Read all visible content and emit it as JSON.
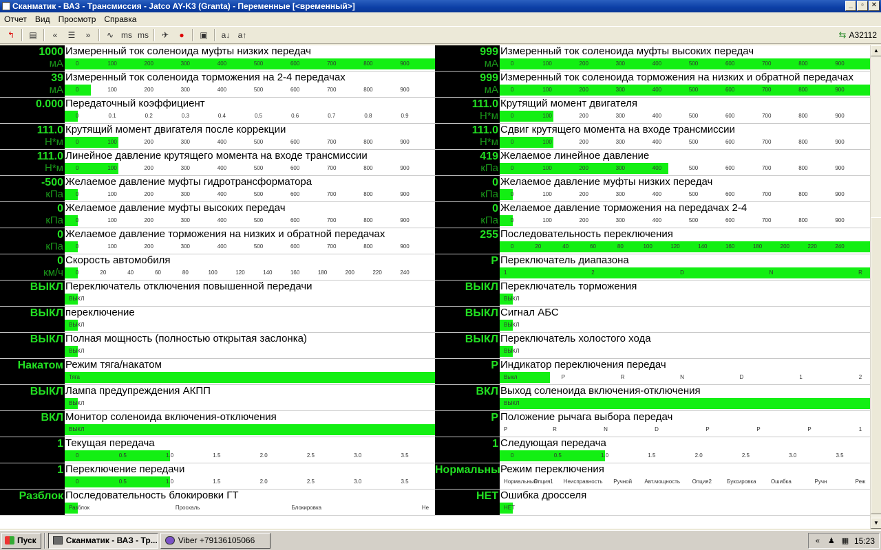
{
  "window": {
    "title": "Сканматик - ВАЗ - Трансмиссия - Jatco AY-K3 (Granta) - Переменные [<временный>]",
    "min": "_",
    "max": "▫",
    "close": "✕"
  },
  "menu": [
    "Отчет",
    "Вид",
    "Просмотр",
    "Справка"
  ],
  "toolbar": {
    "connection": "A32112",
    "icons": [
      "back-arrow-icon",
      "report-icon",
      "prev-icon",
      "list-icon",
      "next-icon",
      "graph-icon",
      "ms-icon",
      "ms-plus-icon",
      "plane-icon",
      "record-icon",
      "snapshot-icon",
      "sort-asc-icon",
      "sort-desc-icon"
    ]
  },
  "scales": {
    "s900": [
      "0",
      "100",
      "200",
      "300",
      "400",
      "500",
      "600",
      "700",
      "800",
      "900"
    ],
    "s09": [
      "0",
      "0.1",
      "0.2",
      "0.3",
      "0.4",
      "0.5",
      "0.6",
      "0.7",
      "0.8",
      "0.9"
    ],
    "s240": [
      "0",
      "20",
      "40",
      "60",
      "80",
      "100",
      "120",
      "140",
      "160",
      "180",
      "200",
      "220",
      "240"
    ],
    "s35": [
      "0",
      "0.5",
      "1.0",
      "1.5",
      "2.0",
      "2.5",
      "3.0",
      "3.5"
    ]
  },
  "left": [
    {
      "value": "1000",
      "unit": "мА",
      "label": "Измеренный ток соленоида муфты низких передач",
      "fill": 1.0,
      "scale": "s900"
    },
    {
      "value": "39",
      "unit": "мА",
      "label": "Измеренный ток соленоида торможения на 2-4 передачах",
      "fill": 0.07,
      "scale": "s900"
    },
    {
      "value": "0.000",
      "unit": "",
      "label": "Передаточный коэффициент",
      "fill": 0.035,
      "scale": "s09"
    },
    {
      "value": "111.0",
      "unit": "Н*м",
      "label": "Крутящий момент двигателя после коррекции",
      "fill": 0.145,
      "scale": "s900"
    },
    {
      "value": "111.0",
      "unit": "Н*м",
      "label": "Линейное давление крутящего момента на входе трансмиссии",
      "fill": 0.145,
      "scale": "s900"
    },
    {
      "value": "-500",
      "unit": "кПа",
      "label": "Желаемое давление муфты гидротрансформатора",
      "fill": 0.035,
      "scale": "s900"
    },
    {
      "value": "0",
      "unit": "кПа",
      "label": "Желаемое давление муфты высоких передач",
      "fill": 0.035,
      "scale": "s900"
    },
    {
      "value": "0",
      "unit": "кПа",
      "label": "Желаемое давление торможения на низких и обратной передачах",
      "fill": 0.035,
      "scale": "s900"
    },
    {
      "value": "0",
      "unit": "км/ч",
      "label": "Скорость автомобиля",
      "fill": 0.035,
      "scale": "s240"
    },
    {
      "value": "ВЫКЛ",
      "unit": "",
      "label": "Переключатель отключения повышенной передачи",
      "fill": 0.035,
      "ticks": [
        "ВЫКЛ"
      ]
    },
    {
      "value": "ВЫКЛ",
      "unit": "",
      "label": " переключение",
      "fill": 0.035,
      "ticks": [
        "ВЫКЛ"
      ]
    },
    {
      "value": "ВЫКЛ",
      "unit": "",
      "label": "Полная мощность (полностью открытая заслонка)",
      "fill": 0.035,
      "ticks": [
        "ВЫКЛ"
      ]
    },
    {
      "value": "Накатом",
      "unit": "",
      "label": "Режим тяга/накатом",
      "fill": 1.0,
      "ticks": [
        "Тяга"
      ]
    },
    {
      "value": "ВЫКЛ",
      "unit": "",
      "label": "Лампа предупреждения АКПП",
      "fill": 0.035,
      "ticks": [
        "ВЫКЛ"
      ]
    },
    {
      "value": "ВКЛ",
      "unit": "",
      "label": "Монитор соленоида включения-отключения",
      "fill": 1.0,
      "ticks": [
        "ВЫКЛ"
      ]
    },
    {
      "value": "1",
      "unit": "",
      "label": "Текущая передача",
      "fill": 0.285,
      "scale": "s35"
    },
    {
      "value": "1",
      "unit": "",
      "label": "Переключение передачи",
      "fill": 0.285,
      "scale": "s35"
    },
    {
      "value": "Разблок",
      "unit": "",
      "label": "Последовательность блокировки ГТ",
      "fill": 0.035,
      "ticks": [
        "Разблок",
        "Проскаль",
        "Блокировка",
        "Не"
      ]
    }
  ],
  "right": [
    {
      "value": "999",
      "unit": "мА",
      "label": "Измеренный ток соленоида муфты высоких передач",
      "fill": 1.0,
      "scale": "s900"
    },
    {
      "value": "999",
      "unit": "мА",
      "label": "Измеренный ток соленоида торможения на низких и обратной передачах",
      "fill": 1.0,
      "scale": "s900",
      "wrap": true
    },
    {
      "value": "111.0",
      "unit": "Н*м",
      "label": "Крутящий момент двигателя",
      "fill": 0.145,
      "scale": "s900"
    },
    {
      "value": "111.0",
      "unit": "Н*м",
      "label": "Сдвиг крутящего момента на входе трансмиссии",
      "fill": 0.145,
      "scale": "s900"
    },
    {
      "value": "419",
      "unit": "кПа",
      "label": "Желаемое линейное давление",
      "fill": 0.455,
      "scale": "s900"
    },
    {
      "value": "0",
      "unit": "кПа",
      "label": "Желаемое давление муфты низких передач",
      "fill": 0.035,
      "scale": "s900"
    },
    {
      "value": "0",
      "unit": "кПа",
      "label": "Желаемое давление торможения на передачах 2-4",
      "fill": 0.035,
      "scale": "s900"
    },
    {
      "value": "255",
      "unit": "",
      "label": "Последовательность переключения",
      "fill": 1.0,
      "scale": "s240"
    },
    {
      "value": "P",
      "unit": "",
      "label": "Переключатель диапазона",
      "fill": 1.0,
      "ticks": [
        "1",
        "2",
        "D",
        "N",
        "R"
      ]
    },
    {
      "value": "ВЫКЛ",
      "unit": "",
      "label": "Переключатель торможения",
      "fill": 0.035,
      "ticks": [
        "ВЫКЛ"
      ]
    },
    {
      "value": "ВЫКЛ",
      "unit": "",
      "label": "Сигнал АБС",
      "fill": 0.035,
      "ticks": [
        "ВЫКЛ"
      ]
    },
    {
      "value": "ВЫКЛ",
      "unit": "",
      "label": "Переключатель холостого хода",
      "fill": 0.035,
      "ticks": [
        "ВЫКЛ"
      ]
    },
    {
      "value": "P",
      "unit": "",
      "label": "Индикатор переключения передач",
      "fill": 0.135,
      "ticks": [
        "Выкл",
        "P",
        "R",
        "N",
        "D",
        "1",
        "2"
      ]
    },
    {
      "value": "ВКЛ",
      "unit": "",
      "label": "Выход соленоида включения-отключения",
      "fill": 1.0,
      "ticks": [
        "ВЫКЛ"
      ]
    },
    {
      "value": "P",
      "unit": "",
      "label": "Положение рычага выбора передач",
      "fill": 0.0,
      "ticks": [
        "P",
        "R",
        "N",
        "D",
        "P",
        "P",
        "P",
        "1"
      ]
    },
    {
      "value": "1",
      "unit": "",
      "label": "Следующая передача",
      "fill": 0.285,
      "scale": "s35"
    },
    {
      "value": "Нормальный",
      "unit": "",
      "label": "Режим переключения",
      "fill": 0.0,
      "ticks": [
        "Нормальный",
        "Опция1",
        "Неисправность",
        "Ручной",
        "Авт.мощность",
        "Опция2",
        "Буксировка",
        "Ошибка",
        "Ручн",
        "Реж"
      ]
    },
    {
      "value": "НЕТ",
      "unit": "",
      "label": "Ошибка дросселя",
      "fill": 0.035,
      "ticks": [
        "НЕТ"
      ]
    }
  ],
  "taskbar": {
    "start": "Пуск",
    "tasks": [
      "Сканматик - ВАЗ - Тр...",
      "Viber +79136105066"
    ],
    "clock": "15:23"
  }
}
